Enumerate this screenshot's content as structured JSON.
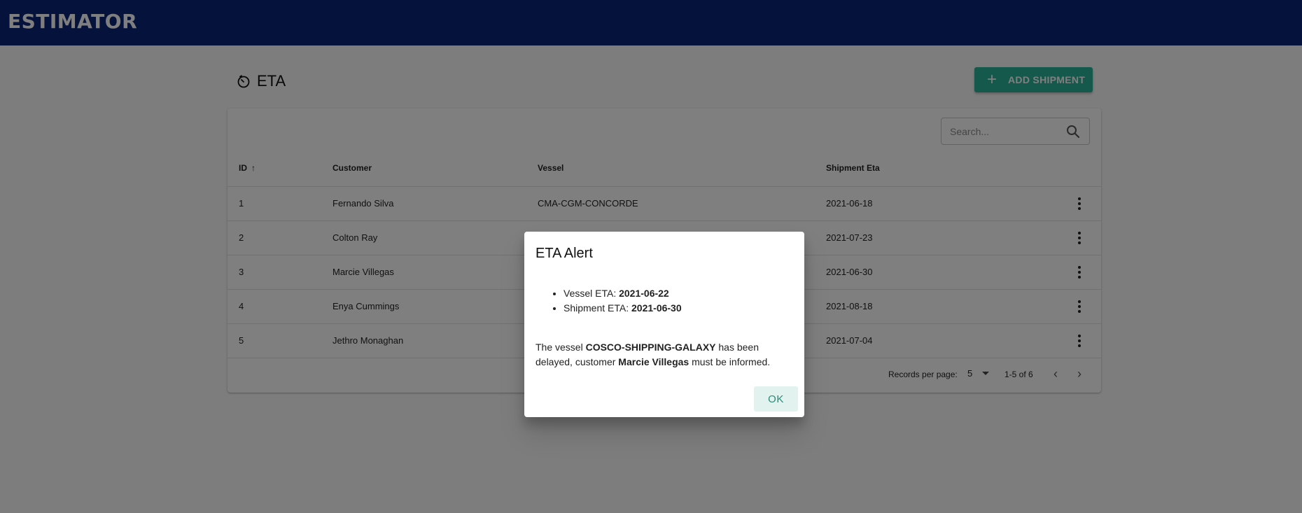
{
  "app": {
    "title": "ESTIMATOR"
  },
  "page": {
    "title": "ETA",
    "add_button_label": "ADD SHIPMENT"
  },
  "search": {
    "placeholder": "Search..."
  },
  "table": {
    "columns": [
      "ID",
      "Customer",
      "Vessel",
      "Shipment Eta"
    ],
    "sorted_column": "ID",
    "sort_direction": "ascending",
    "rows": [
      {
        "id": "1",
        "customer": "Fernando Silva",
        "vessel": "CMA-CGM-CONCORDE",
        "eta": "2021-06-18"
      },
      {
        "id": "2",
        "customer": "Colton Ray",
        "vessel": "",
        "eta": "2021-07-23"
      },
      {
        "id": "3",
        "customer": "Marcie Villegas",
        "vessel": "",
        "eta": "2021-06-30"
      },
      {
        "id": "4",
        "customer": "Enya Cummings",
        "vessel": "",
        "eta": "2021-08-18"
      },
      {
        "id": "5",
        "customer": "Jethro Monaghan",
        "vessel": "",
        "eta": "2021-07-04"
      }
    ]
  },
  "pagination": {
    "label": "Records per page:",
    "per_page": "5",
    "range": "1-5 of 6"
  },
  "dialog": {
    "title": "ETA Alert",
    "vessel_eta_label": "Vessel ETA: ",
    "vessel_eta": "2021-06-22",
    "shipment_eta_label": "Shipment ETA: ",
    "shipment_eta": "2021-06-30",
    "msg_part1": "The vessel ",
    "vessel_name": "COSCO-SHIPPING-GALAXY",
    "msg_part2": " has been delayed, customer ",
    "customer_name": "Marcie Villegas",
    "msg_part3": " must be informed.",
    "ok_label": "OK"
  },
  "colors": {
    "app_bar": "#0a2478",
    "accent": "#2bb39b",
    "overlay": "rgba(0,0,0,0.5)"
  },
  "icons": [
    "timer-icon",
    "plus-icon",
    "search-icon",
    "sort-arrow-up-icon",
    "more-vert-icon",
    "chevron-left-icon",
    "chevron-right-icon",
    "caret-down-icon"
  ]
}
